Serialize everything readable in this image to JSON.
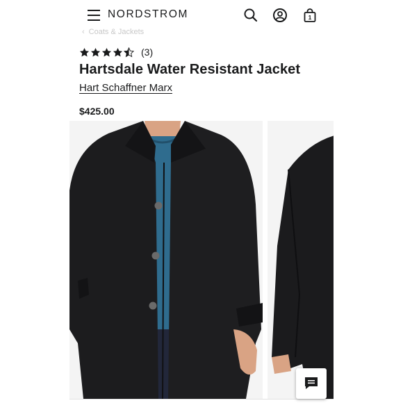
{
  "header": {
    "logo": "NORDSTROM",
    "icons": [
      "menu-icon",
      "search-icon",
      "account-icon",
      "bag-icon"
    ],
    "bag_count": "1"
  },
  "breadcrumb": {
    "label": "Coats & Jackets"
  },
  "product": {
    "rating": 4.5,
    "review_count": "(3)",
    "title": "Hartsdale Water Resistant Jacket",
    "brand": "Hart Schaffner Marx",
    "price": "$425.00"
  },
  "gallery": {
    "images": [
      "main-model-front-view",
      "side-view"
    ]
  },
  "colors": {
    "text": "#191a1b",
    "coat": "#1b1b1d",
    "sweater": "#2f6c8e",
    "background": "#f4f4f4"
  }
}
